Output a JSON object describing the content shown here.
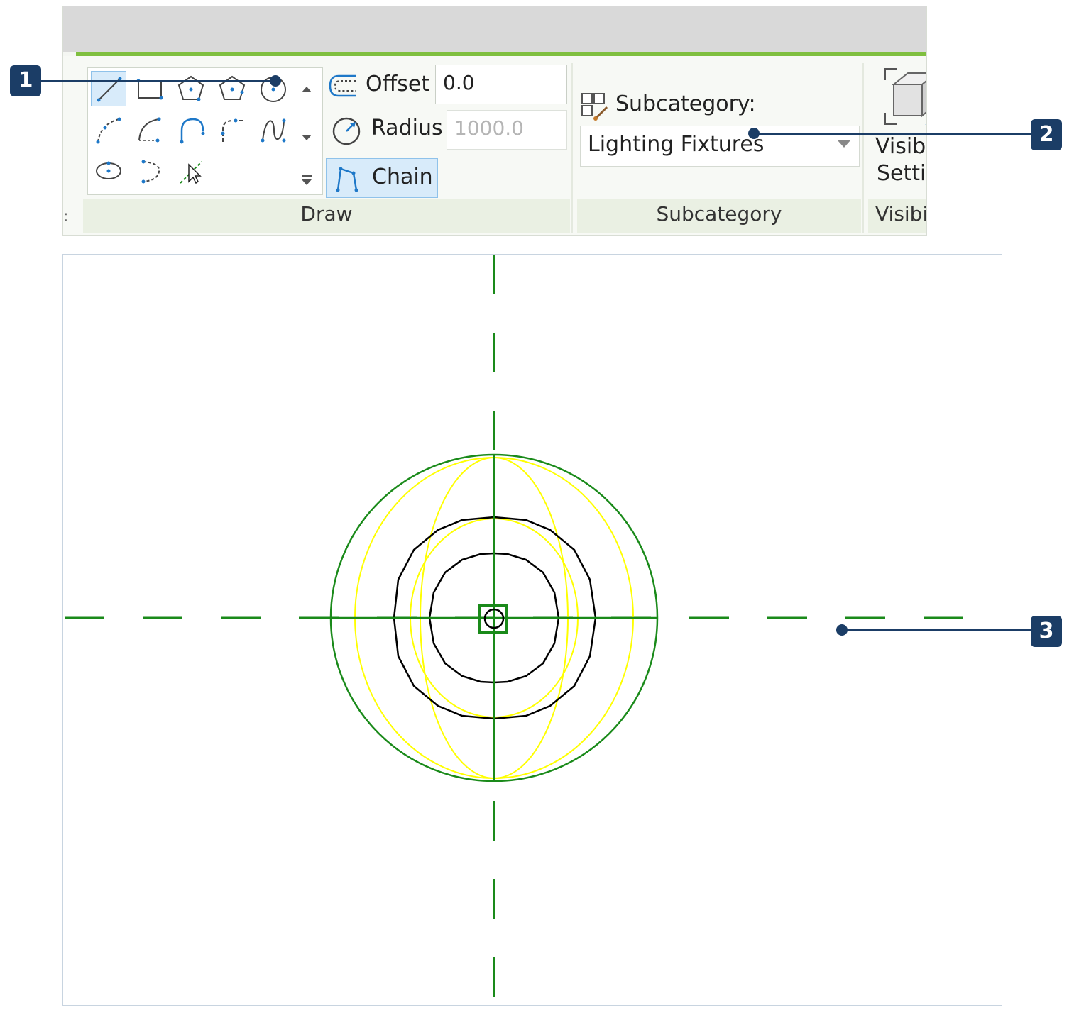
{
  "ribbon": {
    "draw_panel": {
      "label": "Draw",
      "tools": [
        {
          "icon": "line-icon",
          "active": true
        },
        {
          "icon": "rectangle-icon"
        },
        {
          "icon": "inscribed-polygon-icon"
        },
        {
          "icon": "circumscribed-polygon-icon"
        },
        {
          "icon": "circle-icon"
        },
        {
          "icon": "start-end-radius-arc-icon"
        },
        {
          "icon": "center-ends-arc-icon"
        },
        {
          "icon": "tangent-end-arc-icon"
        },
        {
          "icon": "fillet-arc-icon"
        },
        {
          "icon": "spline-icon"
        },
        {
          "icon": "ellipse-icon"
        },
        {
          "icon": "partial-ellipse-icon"
        },
        {
          "icon": "pick-lines-icon"
        }
      ],
      "offset": {
        "label": "Offset",
        "value": "0.0"
      },
      "radius": {
        "label": "Radius",
        "value": "1000.0",
        "enabled": false
      },
      "chain": {
        "label": "Chain",
        "active": true
      }
    },
    "subcategory_panel": {
      "label": "Subcategory",
      "field_label": "Subcategory:",
      "selected": "Lighting Fixtures"
    },
    "visibility_panel": {
      "label": "Visibi",
      "button_line1": "Visibi",
      "button_line2": "Settir"
    }
  },
  "callouts": [
    "1",
    "2",
    "3"
  ],
  "colors": {
    "ribbon_accent": "#7fbf3f",
    "callout": "#1b3d66",
    "reference_line": "#1a8a1a",
    "light_source": "#ffff00",
    "fixture_geometry": "#000000",
    "tool_blue": "#1e78c8"
  }
}
